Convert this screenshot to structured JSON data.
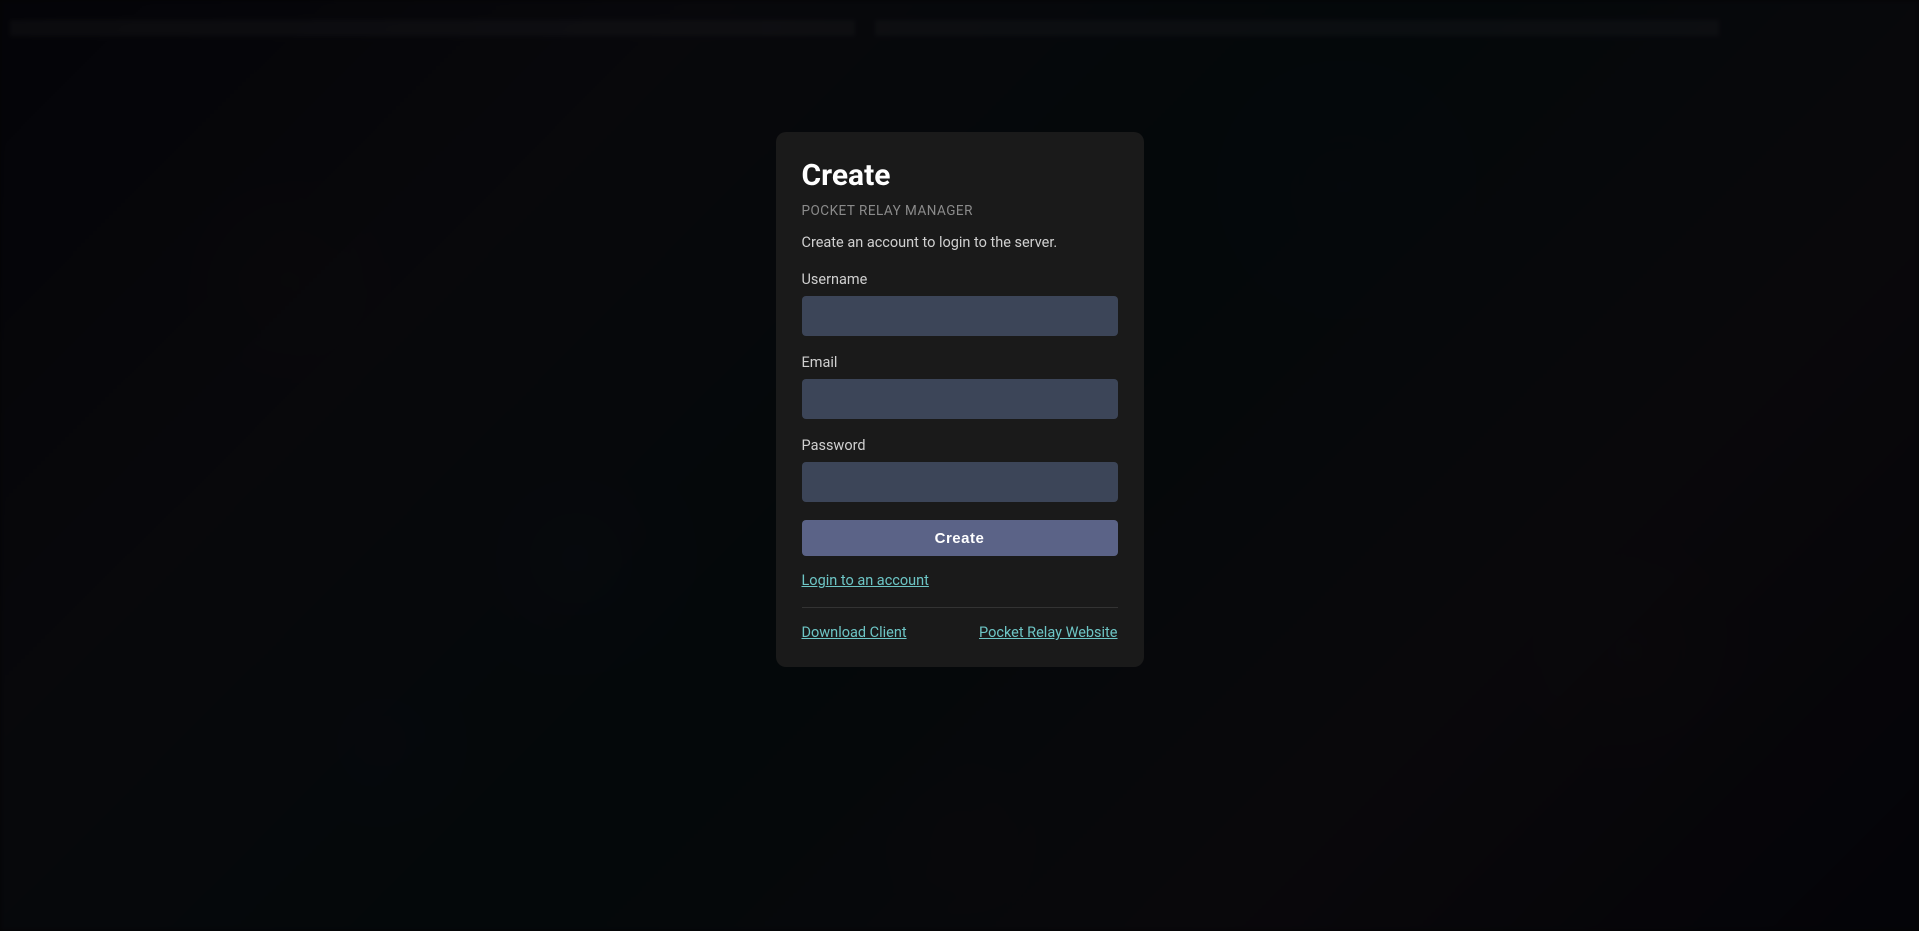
{
  "modal": {
    "title": "Create",
    "subtitle": "POCKET RELAY MANAGER",
    "description": "Create an account to login to the server.",
    "fields": {
      "username": {
        "label": "Username",
        "value": ""
      },
      "email": {
        "label": "Email",
        "value": ""
      },
      "password": {
        "label": "Password",
        "value": ""
      }
    },
    "submit_label": "Create",
    "login_link": "Login to an account",
    "footer": {
      "download_client": "Download Client",
      "website": "Pocket Relay Website"
    }
  }
}
